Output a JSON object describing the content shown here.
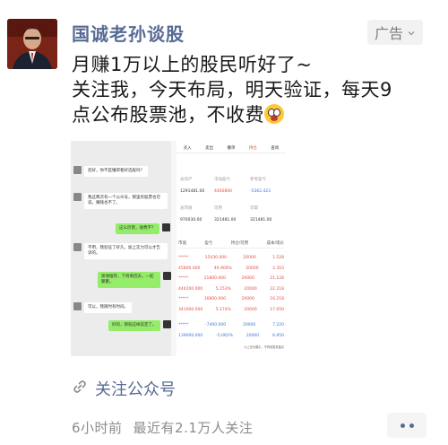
{
  "account": {
    "name": "国诚老孙谈股"
  },
  "ad": {
    "label": "广告"
  },
  "post": {
    "line1": "月赚1万以上的股民听好了~",
    "line2": "关注我，今天布局，明天验证，每天9",
    "line3": "点公布股票池，不收费"
  },
  "preview": {
    "chat": [
      {
        "side": "left",
        "text": "您好，你不是懂得看好选股吗？"
      },
      {
        "side": "left",
        "text": "我这两次有一个公众号，那里有股票也可说，赚钱也不了。"
      },
      {
        "side": "right",
        "text": "这么厉害，收费不？"
      },
      {
        "side": "left",
        "text": "不用，我验证了好久，加上实力可以才告诉的。"
      },
      {
        "side": "right",
        "text": "谢谢推荐，下周来回去，一起聚聚。"
      },
      {
        "side": "left",
        "text": "可以，我随时有时间。"
      },
      {
        "side": "right",
        "text": "好的，那就这样说定了。"
      }
    ],
    "tabs": [
      "买入",
      "卖出",
      "撤单",
      "持仓",
      "查询"
    ],
    "summary": [
      {
        "label": "总资产",
        "value": "1291481.00"
      },
      {
        "label": "浮动盈亏",
        "value": "4460800"
      },
      {
        "label": "参考盈亏",
        "value": "-5362.423"
      },
      {
        "label": "总市值",
        "value": "970030.00"
      },
      {
        "label": "可用",
        "value": "321481.00"
      },
      {
        "label": "可取",
        "value": "321481.00"
      }
    ],
    "table_headers": [
      "市值",
      "盈亏",
      "持仓/可用",
      "成本/现价"
    ],
    "rows": [
      {
        "a": "*****",
        "b": "15430.000",
        "c": "20000",
        "d": "1.528",
        "color": "red"
      },
      {
        "a": "45800.000",
        "b": "49.900%",
        "c": "20000",
        "d": "2.310",
        "color": "red"
      },
      {
        "a": "*****",
        "b": "21800.000",
        "c": "20000",
        "d": "21.128",
        "color": "red"
      },
      {
        "a": "444200.000",
        "b": "5.153%",
        "c": "20000",
        "d": "22.218",
        "color": "red"
      },
      {
        "a": "*****",
        "b": "16800.000",
        "c": "20000",
        "d": "16.218",
        "color": "red"
      },
      {
        "a": "341000.000",
        "b": "5.174%",
        "c": "20000",
        "d": "17.050",
        "color": "red"
      },
      {
        "a": "*****",
        "b": "-7400.000",
        "c": "20000",
        "d": "7.220",
        "color": "blue"
      },
      {
        "a": "139000.000",
        "b": "-5.062%",
        "c": "20000",
        "d": "6.950",
        "color": "blue"
      }
    ],
    "footer": "以上仅为展示，不构成投资建议"
  },
  "follow": {
    "label": "关注公众号"
  },
  "meta": {
    "time": "6小时前",
    "followers": "最近有2.1万人关注"
  }
}
